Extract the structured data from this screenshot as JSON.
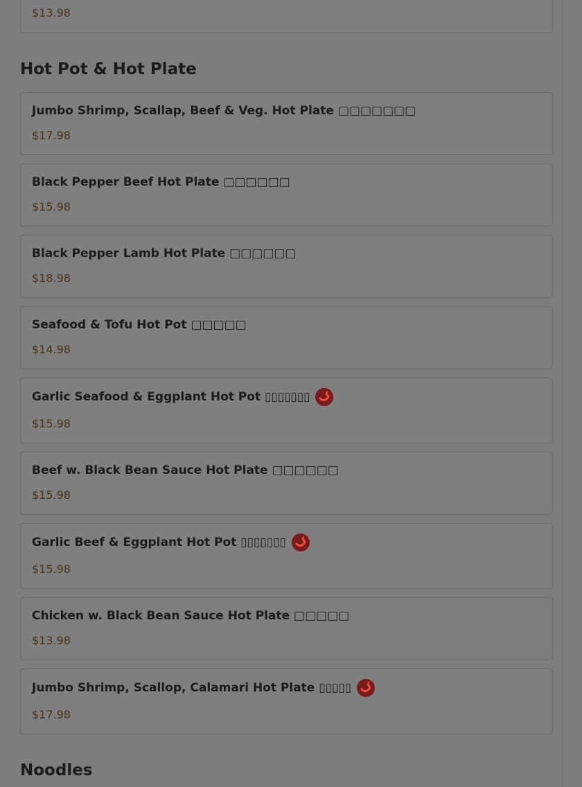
{
  "prev_item": {
    "price": "$13.98"
  },
  "section_hot_pot": {
    "title": "Hot Pot & Hot Plate",
    "items": [
      {
        "name": "Jumbo Shrimp, Scallap, Beef & Veg. Hot Plate □□□□□□□",
        "price": "$17.98",
        "spicy": false
      },
      {
        "name": "Black Pepper Beef Hot Plate □□□□□□",
        "price": "$15.98",
        "spicy": false
      },
      {
        "name": "Black Pepper Lamb Hot Plate □□□□□□",
        "price": "$18.98",
        "spicy": false
      },
      {
        "name": "Seafood & Tofu Hot Pot □□□□□",
        "price": "$14.98",
        "spicy": false
      },
      {
        "name": "Garlic Seafood & Eggplant Hot Pot ▯▯▯▯▯▯▯",
        "price": "$15.98",
        "spicy": true
      },
      {
        "name": "Beef w. Black Bean Sauce Hot Plate □□□□□□",
        "price": "$15.98",
        "spicy": false
      },
      {
        "name": "Garlic Beef & Eggplant Hot Pot ▯▯▯▯▯▯▯",
        "price": "$15.98",
        "spicy": true
      },
      {
        "name": "Chicken w. Black Bean Sauce Hot Plate □□□□□",
        "price": "$13.98",
        "spicy": false
      },
      {
        "name": "Jumbo Shrimp, Scallop, Calamari Hot Plate ▯▯▯▯▯",
        "price": "$17.98",
        "spicy": true
      }
    ]
  },
  "section_noodles": {
    "title": "Noodles"
  },
  "icons": {
    "spicy": "chili-pepper-icon"
  },
  "colors": {
    "spicy_badge": "#7a1a1a",
    "price_text": "#4a3418",
    "overlay_bg": "#7d7d7d"
  }
}
